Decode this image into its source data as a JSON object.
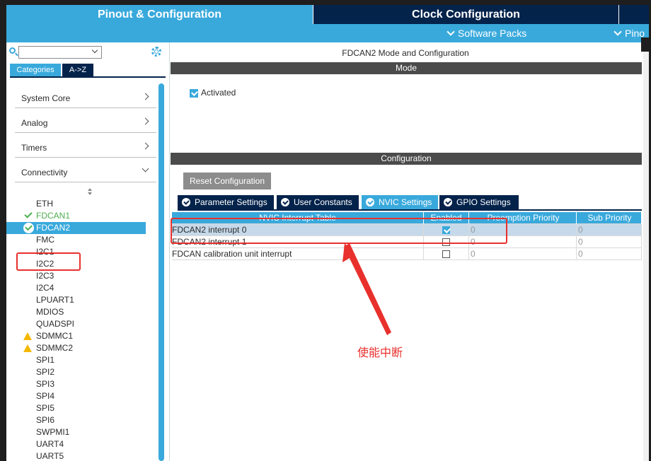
{
  "header": {
    "tabs": [
      "Pinout & Configuration",
      "Clock Configuration",
      ""
    ],
    "software_packs": "Software Packs",
    "pinout_short": "Pino"
  },
  "left": {
    "search_placeholder": "",
    "tabs": [
      "Categories",
      "A->Z"
    ],
    "categories": [
      {
        "label": "System Core",
        "arrow": "right"
      },
      {
        "label": "Analog",
        "arrow": "right"
      },
      {
        "label": "Timers",
        "arrow": "right"
      },
      {
        "label": "Connectivity",
        "arrow": "down"
      }
    ],
    "peripherals": [
      {
        "label": "ETH",
        "state": "none"
      },
      {
        "label": "FDCAN1",
        "state": "enabled"
      },
      {
        "label": "FDCAN2",
        "state": "selected"
      },
      {
        "label": "FMC",
        "state": "none"
      },
      {
        "label": "I2C1",
        "state": "none"
      },
      {
        "label": "I2C2",
        "state": "none"
      },
      {
        "label": "I2C3",
        "state": "none"
      },
      {
        "label": "I2C4",
        "state": "none"
      },
      {
        "label": "LPUART1",
        "state": "none"
      },
      {
        "label": "MDIOS",
        "state": "none"
      },
      {
        "label": "QUADSPI",
        "state": "none"
      },
      {
        "label": "SDMMC1",
        "state": "warning"
      },
      {
        "label": "SDMMC2",
        "state": "warning"
      },
      {
        "label": "SPI1",
        "state": "none"
      },
      {
        "label": "SPI2",
        "state": "none"
      },
      {
        "label": "SPI3",
        "state": "none"
      },
      {
        "label": "SPI4",
        "state": "none"
      },
      {
        "label": "SPI5",
        "state": "none"
      },
      {
        "label": "SPI6",
        "state": "none"
      },
      {
        "label": "SWPMI1",
        "state": "none"
      },
      {
        "label": "UART4",
        "state": "none"
      },
      {
        "label": "UART5",
        "state": "none"
      }
    ]
  },
  "right": {
    "title": "FDCAN2 Mode and Configuration",
    "mode_bar": "Mode",
    "activated_label": "Activated",
    "config_bar": "Configuration",
    "reset_button": "Reset Configuration",
    "config_tabs": [
      "Parameter Settings",
      "User Constants",
      "NVIC Settings",
      "GPIO Settings"
    ],
    "table": {
      "headers": [
        "NVIC Interrupt Table",
        "Enabled",
        "Preemption Priority",
        "Sub Priority"
      ],
      "rows": [
        {
          "name": "FDCAN2 interrupt 0",
          "enabled": true,
          "preemption": "0",
          "sub": "0"
        },
        {
          "name": "FDCAN2 interrupt 1",
          "enabled": false,
          "preemption": "0",
          "sub": "0"
        },
        {
          "name": "FDCAN calibration unit interrupt",
          "enabled": false,
          "preemption": "0",
          "sub": "0"
        }
      ]
    }
  },
  "annotation": {
    "text": "使能中断"
  },
  "colors": {
    "accent": "#39a9dc",
    "dark": "#03234b",
    "annotation": "#e8302c",
    "ok": "#4caf50",
    "warning": "#f5b800"
  }
}
